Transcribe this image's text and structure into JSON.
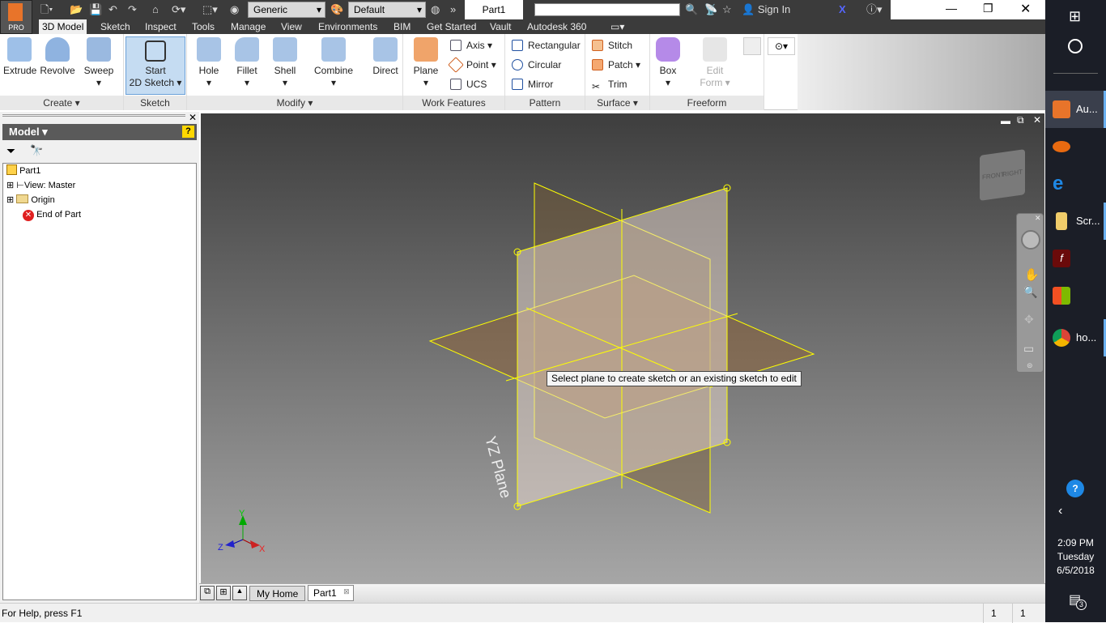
{
  "app": {
    "badge": "PRO",
    "document_title": "Part1"
  },
  "quick_access": {
    "material": "Generic",
    "appearance": "Default"
  },
  "infocenter": {
    "search_value": "",
    "sign_in": "Sign In"
  },
  "ribbon_tabs": [
    "3D Model",
    "Sketch",
    "Inspect",
    "Tools",
    "Manage",
    "View",
    "Environments",
    "BIM",
    "Get Started",
    "Vault",
    "Autodesk 360"
  ],
  "ribbon": {
    "create": {
      "label": "Create",
      "items": [
        "Extrude",
        "Revolve",
        "Sweep"
      ]
    },
    "sketch": {
      "label": "Sketch",
      "start_l1": "Start",
      "start_l2": "2D Sketch"
    },
    "modify": {
      "label": "Modify",
      "items": [
        "Hole",
        "Fillet",
        "Shell",
        "Combine",
        "Direct"
      ]
    },
    "work_features": {
      "label": "Work Features",
      "plane": "Plane",
      "axis": "Axis",
      "point": "Point",
      "ucs": "UCS"
    },
    "pattern": {
      "label": "Pattern",
      "rectangular": "Rectangular",
      "circular": "Circular",
      "mirror": "Mirror"
    },
    "surface": {
      "label": "Surface",
      "stitch": "Stitch",
      "patch": "Patch",
      "trim": "Trim"
    },
    "freeform": {
      "label": "Freeform",
      "box": "Box",
      "edit_l1": "Edit",
      "edit_l2": "Form"
    }
  },
  "browser": {
    "title": "Model",
    "tree": [
      "Part1",
      "View: Master",
      "Origin",
      "End of Part"
    ]
  },
  "viewport": {
    "plane_label": "YZ Plane",
    "tooltip": "Select plane to create sketch or an existing sketch to edit",
    "viewcube": {
      "front": "FRONT",
      "right": "RIGHT"
    },
    "axes": {
      "x": "X",
      "y": "Y",
      "z": "Z"
    }
  },
  "doc_tabs": [
    "My Home",
    "Part1"
  ],
  "status": {
    "help": "For Help, press F1",
    "count1": "1",
    "count2": "1"
  },
  "taskbar": {
    "apps": [
      "Au...",
      "",
      "",
      "Scr...",
      "",
      "",
      "ho..."
    ],
    "time": "2:09 PM",
    "day": "Tuesday",
    "date": "6/5/2018",
    "notifications": "3"
  }
}
